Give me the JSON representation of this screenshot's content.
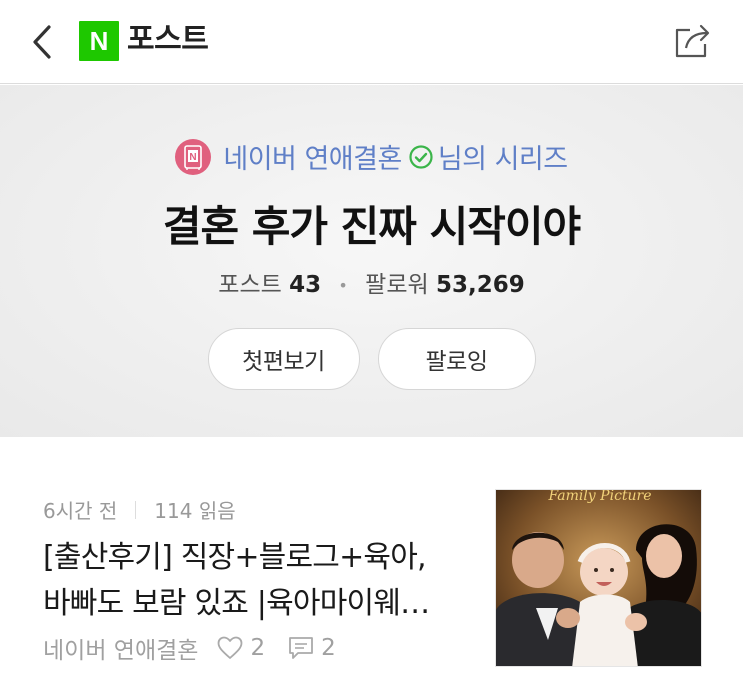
{
  "topbar": {
    "logo_letter": "N",
    "title": "포스트"
  },
  "series": {
    "author_name": "네이버 연애결혼",
    "author_suffix": "님의 시리즈",
    "title": "결혼 후가 진짜 시작이야",
    "posts_label": "포스트",
    "posts_count": "43",
    "followers_label": "팔로워",
    "followers_count": "53,269",
    "first_button": "첫편보기",
    "follow_button": "팔로잉"
  },
  "posts": [
    {
      "time": "6시간 전",
      "views": "114 읽음",
      "title_line1": "[출산후기] 직장+블로그+육아,",
      "title_line2": "바빠도 보람 있죠 |육아마이웨…",
      "author": "네이버 연애결혼",
      "likes": "2",
      "comments": "2",
      "thumb_text": "Family Picture"
    }
  ],
  "colors": {
    "naver_green": "#1ec800",
    "author_blue": "#5f7fc7",
    "verified_green": "#3bb54a",
    "avatar_pink": "#e0607e"
  },
  "icons": {
    "back": "chevron-left-icon",
    "share": "share-icon",
    "verified": "check-circle-icon",
    "like": "heart-icon",
    "comment": "comment-icon"
  }
}
